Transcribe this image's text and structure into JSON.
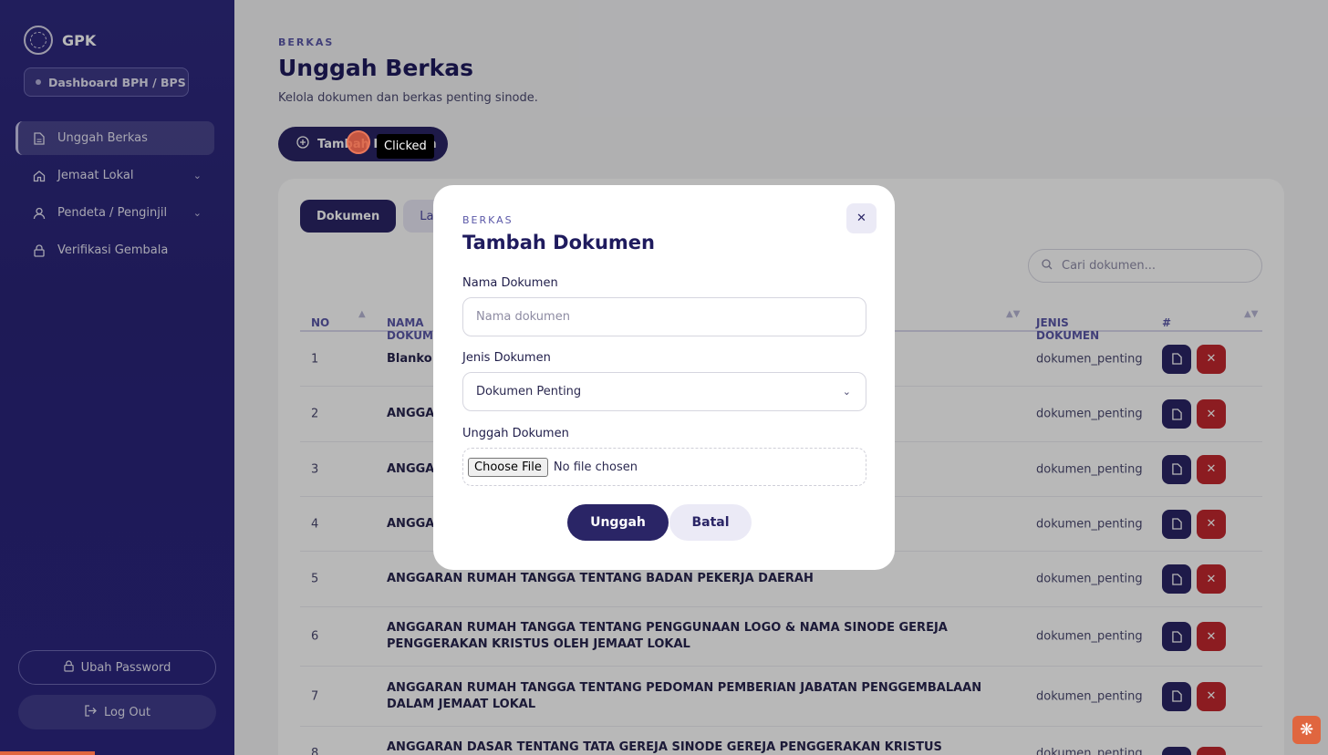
{
  "brand": {
    "name": "GPK"
  },
  "role": {
    "label": "Dashboard BPH / BPS"
  },
  "sidebar": {
    "items": [
      {
        "label": "Unggah Berkas",
        "icon": "file-icon",
        "active": true
      },
      {
        "label": "Jemaat Lokal",
        "icon": "home-icon",
        "expandable": true
      },
      {
        "label": "Pendeta / Penginjil",
        "icon": "user-icon",
        "expandable": true
      },
      {
        "label": "Verifikasi Gembala",
        "icon": "lock-icon"
      }
    ],
    "change_password": "Ubah Password",
    "logout": "Log Out"
  },
  "header": {
    "eyebrow": "BERKAS",
    "title": "Unggah Berkas",
    "subtitle": "Kelola dokumen dan berkas penting sinode.",
    "add_button": "Tambah Dokumen"
  },
  "tabs": [
    {
      "label": "Dokumen",
      "active": true
    },
    {
      "label": "Laporan",
      "active": false
    }
  ],
  "search": {
    "placeholder": "Cari dokumen..."
  },
  "table": {
    "columns": [
      "NO",
      "NAMA DOKUMEN",
      "JENIS DOKUMEN",
      "#"
    ],
    "rows": [
      {
        "no": "1",
        "name": "Blanko K",
        "type": "dokumen_penting"
      },
      {
        "no": "2",
        "name": "ANGGAR",
        "type": "dokumen_penting"
      },
      {
        "no": "3",
        "name": "ANGGAR",
        "type": "dokumen_penting"
      },
      {
        "no": "4",
        "name": "ANGGAR",
        "type": "dokumen_penting"
      },
      {
        "no": "5",
        "name": "ANGGARAN RUMAH TANGGA TENTANG BADAN PEKERJA DAERAH",
        "type": "dokumen_penting"
      },
      {
        "no": "6",
        "name": "ANGGARAN RUMAH TANGGA TENTANG PENGGUNAAN LOGO & NAMA SINODE GEREJA PENGGERAKAN KRISTUS OLEH JEMAAT LOKAL",
        "type": "dokumen_penting"
      },
      {
        "no": "7",
        "name": "ANGGARAN RUMAH TANGGA TENTANG PEDOMAN PEMBERIAN JABATAN PENGGEMBALAAN DALAM JEMAAT LOKAL",
        "type": "dokumen_penting"
      },
      {
        "no": "8",
        "name": "ANGGARAN DASAR TENTANG TATA GEREJA SINODE GEREJA PENGGERAKAN KRISTUS (PINKSTER BEWEGING)",
        "type": "dokumen_penting"
      }
    ]
  },
  "modal": {
    "eyebrow": "BERKAS",
    "title": "Tambah Dokumen",
    "name_label": "Nama Dokumen",
    "name_placeholder": "Nama dokumen",
    "type_label": "Jenis Dokumen",
    "type_value": "Dokumen Penting",
    "upload_label": "Unggah Dokumen",
    "choose_file": "Choose File",
    "no_file": "No file chosen",
    "submit": "Unggah",
    "cancel": "Batal"
  },
  "click_indicator": {
    "label": "Clicked"
  },
  "colors": {
    "primary": "#2a2566",
    "danger": "#c2282e",
    "accent": "#e0663f",
    "sidebar": "#2f2a80"
  }
}
